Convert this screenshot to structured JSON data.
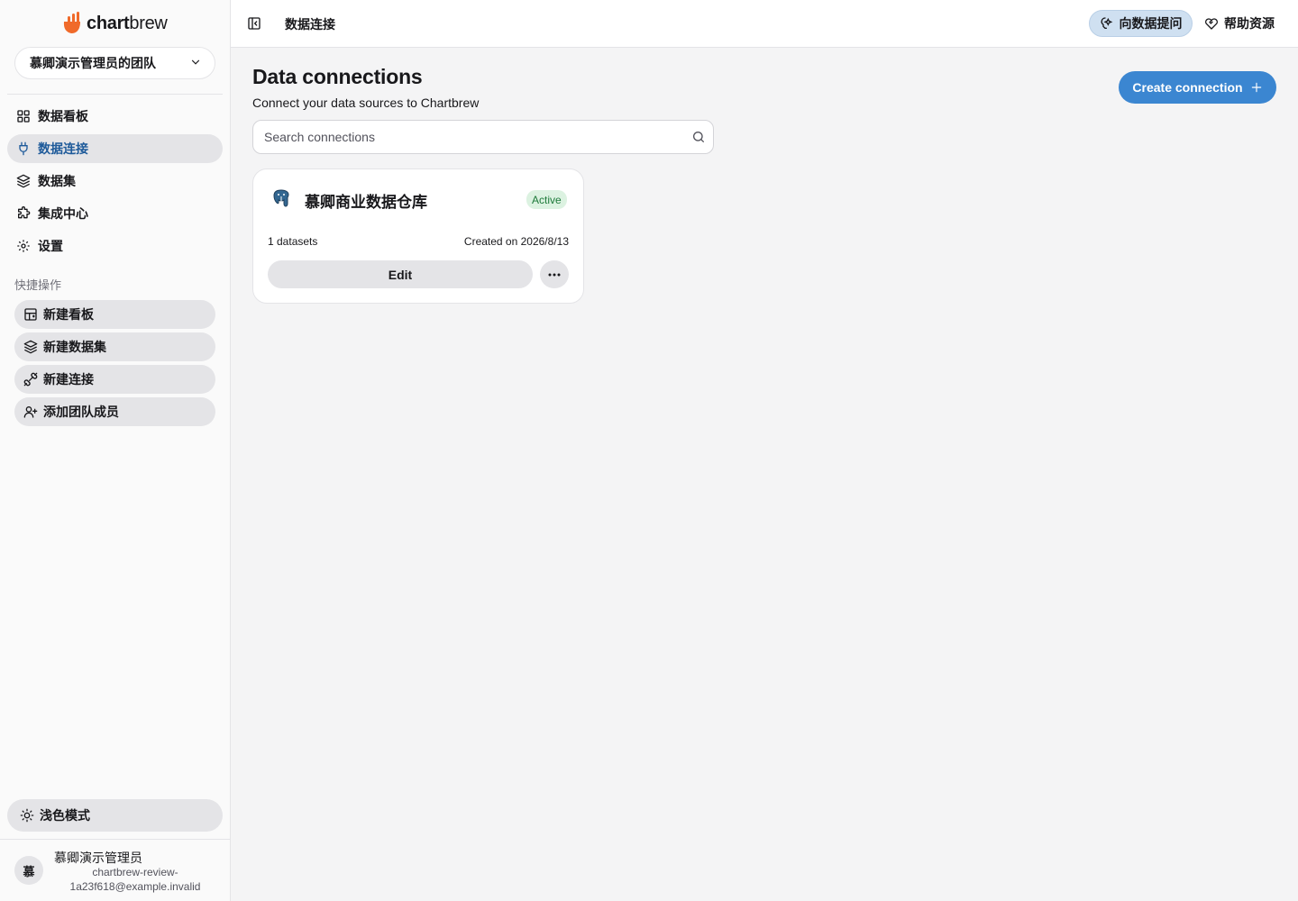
{
  "brand": {
    "name_bold": "chart",
    "name_rest": "brew"
  },
  "team": {
    "selected": "慕卿演示管理员的团队"
  },
  "nav": {
    "items": [
      {
        "label": "数据看板",
        "icon": "grid-icon",
        "active": false
      },
      {
        "label": "数据连接",
        "icon": "plug-icon",
        "active": true
      },
      {
        "label": "数据集",
        "icon": "layers-icon",
        "active": false
      },
      {
        "label": "集成中心",
        "icon": "puzzle-icon",
        "active": false
      },
      {
        "label": "设置",
        "icon": "gear-icon",
        "active": false
      }
    ]
  },
  "quick": {
    "label": "快捷操作",
    "items": [
      {
        "label": "新建看板",
        "icon": "dashboard-add-icon"
      },
      {
        "label": "新建数据集",
        "icon": "layers-icon"
      },
      {
        "label": "新建连接",
        "icon": "plug-connect-icon"
      },
      {
        "label": "添加团队成员",
        "icon": "user-add-icon"
      }
    ]
  },
  "theme": {
    "label": "浅色模式"
  },
  "user": {
    "initial": "慕",
    "name": "慕卿演示管理员",
    "email": "chartbrew-review-1a23f618@example.invalid"
  },
  "topbar": {
    "title": "数据连接",
    "ask_label": "向数据提问",
    "help_label": "帮助资源"
  },
  "page": {
    "title": "Data connections",
    "subtitle": "Connect your data sources to Chartbrew",
    "create_label": "Create connection"
  },
  "search": {
    "placeholder": "Search connections",
    "value": ""
  },
  "connections": [
    {
      "name": "慕卿商业数据仓库",
      "status": "Active",
      "datasets": "1 datasets",
      "created": "Created on 2026/8/13",
      "edit_label": "Edit",
      "icon": "postgres-icon"
    }
  ],
  "colors": {
    "accent": "#3b86d1",
    "active_nav_text": "#1e5a9a",
    "badge_bg": "#dcf2e1",
    "badge_text": "#1e7a3a",
    "ask_bg": "#cfe0f1"
  }
}
